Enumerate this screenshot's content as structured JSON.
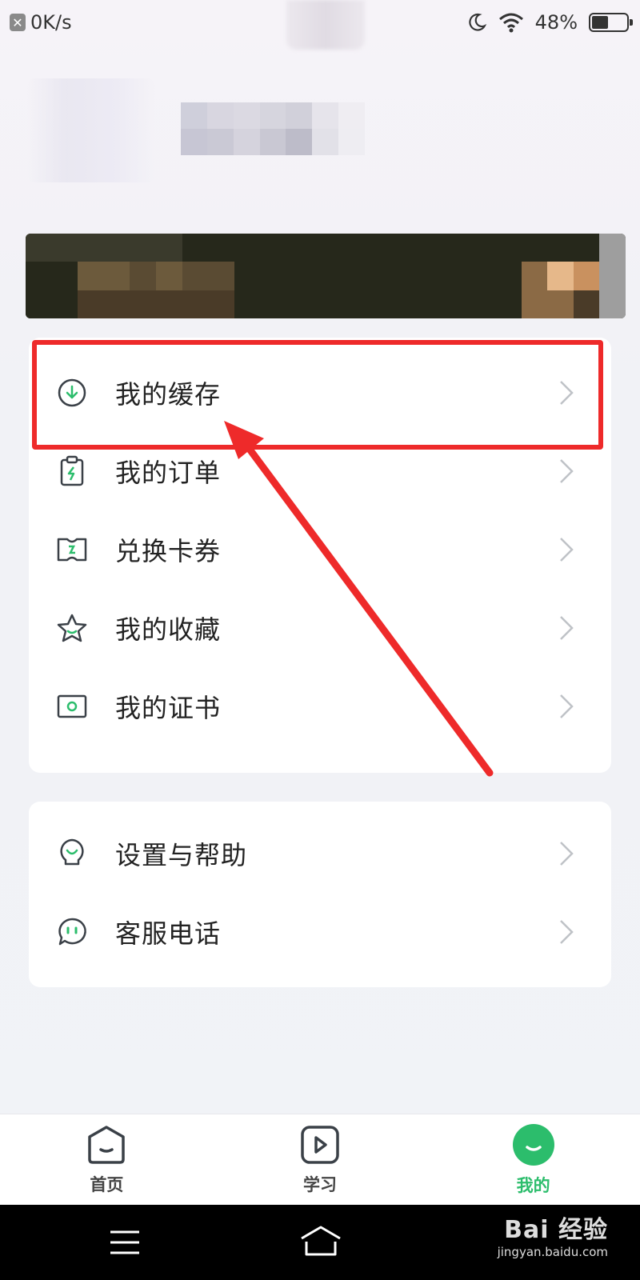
{
  "status_bar": {
    "net_speed": "0K/s",
    "battery_percent": "48%",
    "battery_level": 0.48
  },
  "menu_group_1": [
    {
      "label": "我的缓存",
      "icon": "download-circle-icon"
    },
    {
      "label": "我的订单",
      "icon": "clipboard-bolt-icon"
    },
    {
      "label": "兑换卡券",
      "icon": "ticket-icon"
    },
    {
      "label": "我的收藏",
      "icon": "star-icon"
    },
    {
      "label": "我的证书",
      "icon": "certificate-icon"
    }
  ],
  "menu_group_2": [
    {
      "label": "设置与帮助",
      "icon": "bulb-icon"
    },
    {
      "label": "客服电话",
      "icon": "chat-bubble-icon"
    }
  ],
  "bottom_nav": [
    {
      "label": "首页",
      "icon": "home-icon",
      "active": false
    },
    {
      "label": "学习",
      "icon": "play-icon",
      "active": false
    },
    {
      "label": "我的",
      "icon": "profile-smile-icon",
      "active": true
    }
  ],
  "watermark": {
    "main": "Bai 经验",
    "sub": "jingyan.baidu.com"
  },
  "colors": {
    "accent_green": "#2cbd6c",
    "highlight_red": "#ee2a2a"
  }
}
